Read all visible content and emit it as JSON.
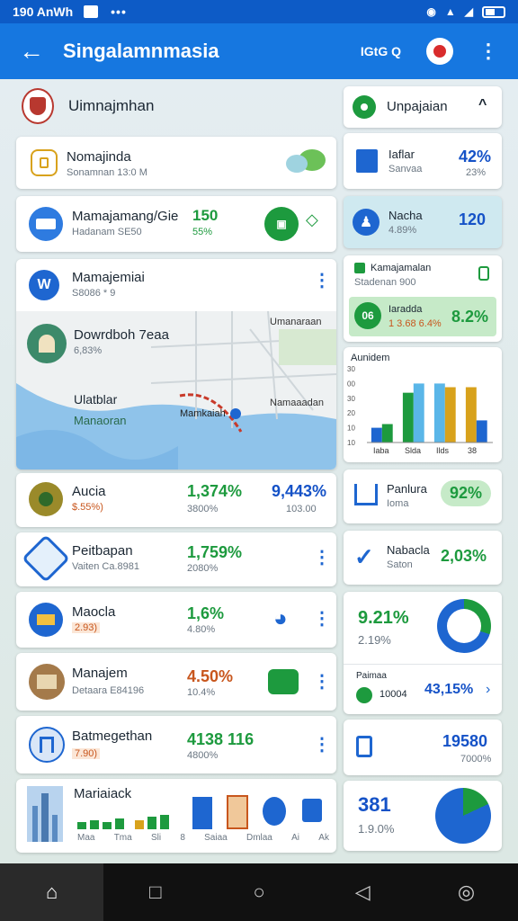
{
  "status": {
    "time": "190 AnWh",
    "dots": "•••",
    "carrier": "№"
  },
  "appbar": {
    "title": "Singalamnmasia",
    "search_label": "IGtG Q"
  },
  "colors": {
    "primary": "#1677e0",
    "status": "#0d5bc6",
    "green": "#1d9a3e",
    "blue": "#1552c7"
  },
  "left": {
    "header": {
      "title": "Uimnajmhan"
    },
    "c1": {
      "label": "Nomajinda",
      "sub": "Sonamnan 13:0 M"
    },
    "c2": {
      "label": "Mamajamang/Gie",
      "sub": "Hadanam SE50",
      "v1": "150",
      "v2": "55%"
    },
    "c3": {
      "label": "Mamajemiai",
      "sub": "S8086 * 9"
    },
    "map": {
      "place1": "Dowrdboh 7eaa",
      "place1_sub": "6,83%",
      "lbl_a": "Ulatblar",
      "lbl_b": "Manaoran",
      "lbl_c": "Mamkaiah",
      "lbl_d": "Namaaadan",
      "lbl_top": "Umanaraan"
    },
    "r1": {
      "label": "Aucia",
      "sub": "$.55%)",
      "v1": "1,374%",
      "v1sub": "3800%",
      "v2": "9,443%",
      "v2sub": "103.00"
    },
    "r2": {
      "label": "Peitbapan",
      "sub": "Vaiten Ca.8981",
      "v1": "1,759%",
      "v1sub": "2080%"
    },
    "r3": {
      "label": "Maocla",
      "sub": "2.93)",
      "v1": "1,6%",
      "v1sub": "4.80%"
    },
    "r4": {
      "label": "Manajem",
      "sub": "Detaara E84196",
      "v1": "4.50%",
      "v1sub": "10.4%"
    },
    "r5": {
      "label": "Batmegethan",
      "sub": "7.90)",
      "v1": "4138 116",
      "v1sub": "4800%"
    },
    "r6": {
      "label": "Mariaiack",
      "ticks": [
        "Maa",
        "Tma",
        "Sli",
        "8",
        "Saiaa",
        "Dmlaa",
        "Ai",
        "Ak"
      ]
    }
  },
  "right": {
    "h1": {
      "label": "Unpajaian"
    },
    "c1": {
      "label": "Iaflar",
      "sub": "Sanvaa",
      "val": "42%",
      "valsub": "23%"
    },
    "c2": {
      "label": "Nacha",
      "sub": "4.89%",
      "val": "120"
    },
    "c3": {
      "label": "Kamajamalan",
      "sub": "Stadenan 900"
    },
    "c4": {
      "label": "Iaradda",
      "sub": "1 3.68 6.4%",
      "badge": "06",
      "val": "8.2%"
    },
    "chart": {
      "title": "Aunidem",
      "yticks": [
        "30",
        "00",
        "30",
        "20",
        "10",
        "10"
      ],
      "xticks": [
        "Iaba",
        "Slda",
        "Ilds",
        "38"
      ]
    },
    "c5": {
      "label": "Panlura",
      "sub": "Ioma",
      "val": "92%"
    },
    "c6": {
      "label": "Nabacla",
      "sub": "Saton",
      "val": "2,03%"
    },
    "c7": {
      "val": "9.21%",
      "sub": "2.19%"
    },
    "c8": {
      "label": "Paimaa",
      "sub": "10004",
      "val": "43,15%"
    },
    "c9": {
      "val": "19580",
      "sub": "7000%"
    },
    "c10": {
      "val": "381",
      "sub": "1.9.0%"
    }
  },
  "chart_data": {
    "type": "bar",
    "categories": [
      "Iaba",
      "Slda",
      "Ilds",
      "38"
    ],
    "series": [
      {
        "values": [
          8,
          27,
          32,
          30
        ]
      },
      {
        "values": [
          10,
          32,
          30,
          12
        ]
      }
    ],
    "title": "Aunidem",
    "ylim": [
      0,
      40
    ]
  }
}
